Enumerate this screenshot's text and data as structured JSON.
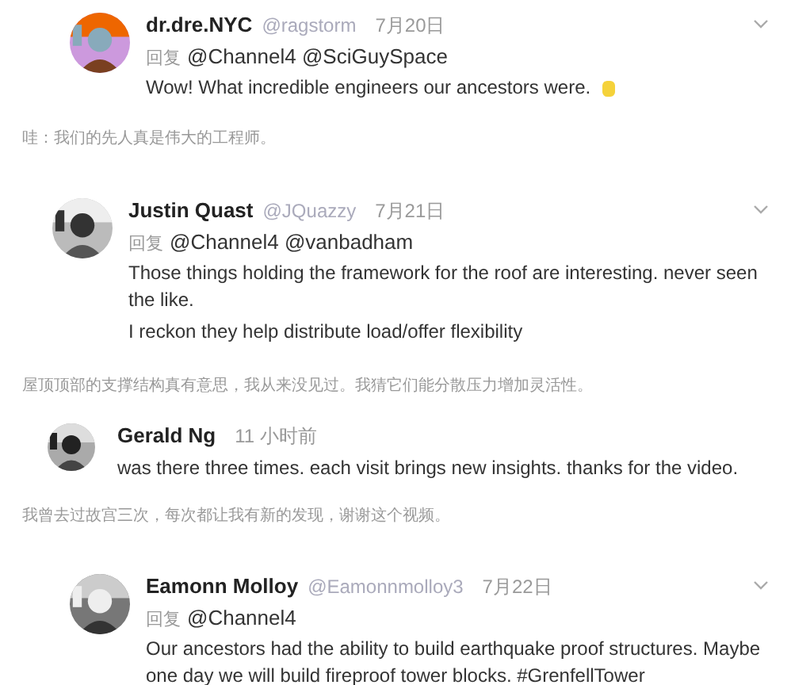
{
  "comments": [
    {
      "kind": "tweet",
      "name": "dr.dre.NYC",
      "handle": "@ragstorm",
      "date": "7月20日",
      "reply_label": "回复",
      "reply_to": "@Channel4 @SciGuySpace",
      "lines": [
        "Wow! What incredible engineers our ancestors were."
      ],
      "emoji": true,
      "translation": "哇：我们的先人真是伟大的工程师。"
    },
    {
      "kind": "tweet",
      "name": "Justin Quast",
      "handle": "@JQuazzy",
      "date": "7月21日",
      "reply_label": "回复",
      "reply_to": "@Channel4 @vanbadham",
      "lines": [
        "Those things holding the framework for the roof are interesting. never seen the like.",
        "I reckon they help distribute load/offer flexibility"
      ],
      "emoji": false,
      "translation": "屋顶顶部的支撑结构真有意思，我从来没见过。我猜它们能分散压力增加灵活性。"
    },
    {
      "kind": "comment",
      "name": "Gerald Ng",
      "date": "11 小时前",
      "lines": [
        "was there three times. each visit brings new insights. thanks for the video."
      ],
      "emoji": false,
      "translation": "我曾去过故宫三次，每次都让我有新的发现，谢谢这个视频。"
    },
    {
      "kind": "tweet",
      "name": "Eamonn Molloy",
      "handle": "@Eamonnmolloy3",
      "date": "7月22日",
      "reply_label": "回复",
      "reply_to": "@Channel4",
      "lines": [
        "Our ancestors had the ability to build earthquake proof structures. Maybe one day we will  build fireproof tower blocks. #GrenfellTower"
      ],
      "emoji": false
    }
  ]
}
